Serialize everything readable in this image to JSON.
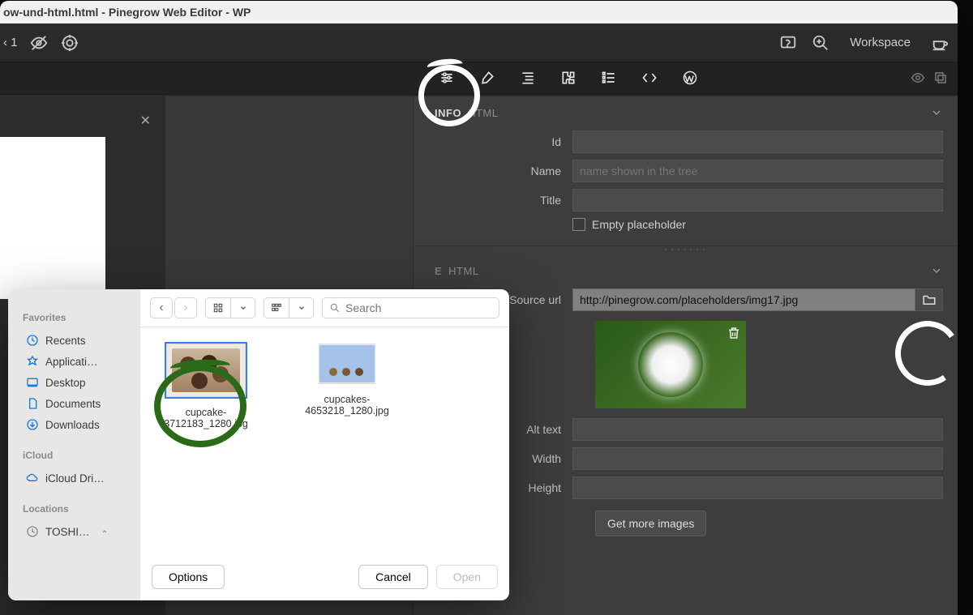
{
  "titlebar": "ow-und-html.html - Pinegrow Web Editor - WP",
  "topbar": {
    "zoom_label": "‹ 1",
    "workspace": "Workspace"
  },
  "panels": {
    "info": {
      "section_a": "INFO",
      "section_b": "HTML",
      "id_label": "Id",
      "name_label": "Name",
      "name_placeholder": "name shown in the tree",
      "title_label": "Title",
      "empty_label": "Empty placeholder"
    },
    "image": {
      "section_a": "E",
      "section_b": "HTML",
      "source_label": "Source url",
      "source_value": "http://pinegrow.com/placeholders/img17.jpg",
      "alt_label": "Alt text",
      "width_label": "Width",
      "height_label": "Height",
      "getmore": "Get more images"
    }
  },
  "finder": {
    "groups": {
      "favorites": "Favorites",
      "icloud": "iCloud",
      "locations": "Locations"
    },
    "items": {
      "recents": "Recents",
      "applications": "Applicati…",
      "desktop": "Desktop",
      "documents": "Documents",
      "downloads": "Downloads",
      "iclouddrive": "iCloud Dri…",
      "toshi": "TOSHI…"
    },
    "search_placeholder": "Search",
    "files": [
      {
        "name": "cupcake-3712183_1280.jpg"
      },
      {
        "name": "cupcakes-4653218_1280.jpg"
      }
    ],
    "buttons": {
      "options": "Options",
      "cancel": "Cancel",
      "open": "Open"
    }
  }
}
